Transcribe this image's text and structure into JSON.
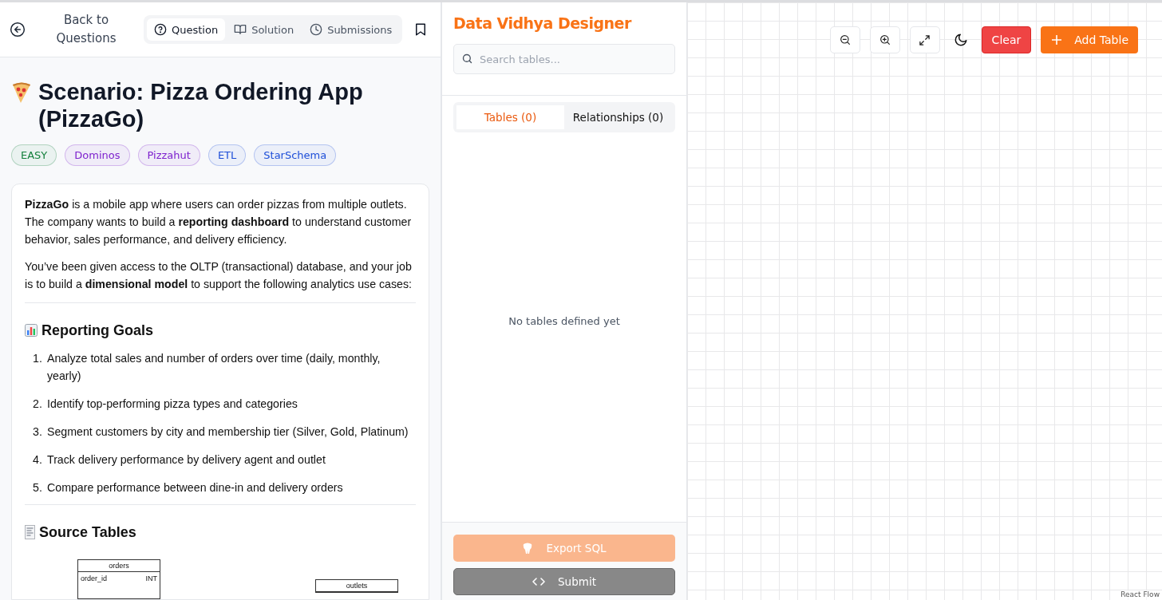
{
  "question_panel": {
    "back_label": "Back to Questions",
    "tabs": [
      {
        "label": "Question",
        "selected": true
      },
      {
        "label": "Solution",
        "selected": false
      },
      {
        "label": "Submissions",
        "selected": false
      }
    ],
    "title": "Scenario: Pizza Ordering App (PizzaGo)",
    "tags": [
      {
        "label": "EASY",
        "color": "#15803d"
      },
      {
        "label": "Dominos",
        "color": "#7e22ce"
      },
      {
        "label": "Pizzahut",
        "color": "#7e22ce"
      },
      {
        "label": "ETL",
        "color": "#1d4ed8"
      },
      {
        "label": "StarSchema",
        "color": "#1d4ed8"
      }
    ],
    "paragraphs": [
      "**PizzaGo** is a mobile app where users can order pizzas from multiple outlets. The company wants to build a **reporting dashboard** to understand customer behavior, sales performance, and delivery efficiency.",
      "You’ve been given access to the OLTP (transactional) database, and your job is to build a **dimensional model** to support the following analytics use cases:"
    ],
    "goals_heading": "Reporting Goals",
    "goals": [
      {
        "number": "1.",
        "text": "Analyze total sales and number of orders over time (daily, monthly, yearly)"
      },
      {
        "number": "2.",
        "text": "Identify top-performing pizza types and categories"
      },
      {
        "number": "3.",
        "text": "Segment customers by city and membership tier (Silver, Gold, Platinum)"
      },
      {
        "number": "4.",
        "text": "Track delivery performance by delivery agent and outlet"
      },
      {
        "number": "5.",
        "text": "Compare performance between dine-in and delivery orders"
      }
    ],
    "source_heading": "Source Tables",
    "diagram": {
      "tables": [
        {
          "name": "orders",
          "columns": [
            {
              "name": "order_id",
              "type": "INT"
            }
          ]
        },
        {
          "name": "outlets"
        }
      ]
    }
  },
  "designer": {
    "title": "Data Vidhya Designer",
    "search": {
      "placeholder": "Search tables..."
    },
    "tabs": [
      {
        "label": "Tables (0)",
        "selected": true
      },
      {
        "label": "Relationships (0)",
        "selected": false
      }
    ],
    "empty_message": "No tables defined yet",
    "export_button": {
      "label": "Export SQL",
      "disabled": true
    },
    "submit_button": {
      "label": "Submit",
      "disabled": true
    }
  },
  "canvas": {
    "clear_button": "Clear",
    "add_button": "Add Table",
    "attribution": "React Flow"
  }
}
